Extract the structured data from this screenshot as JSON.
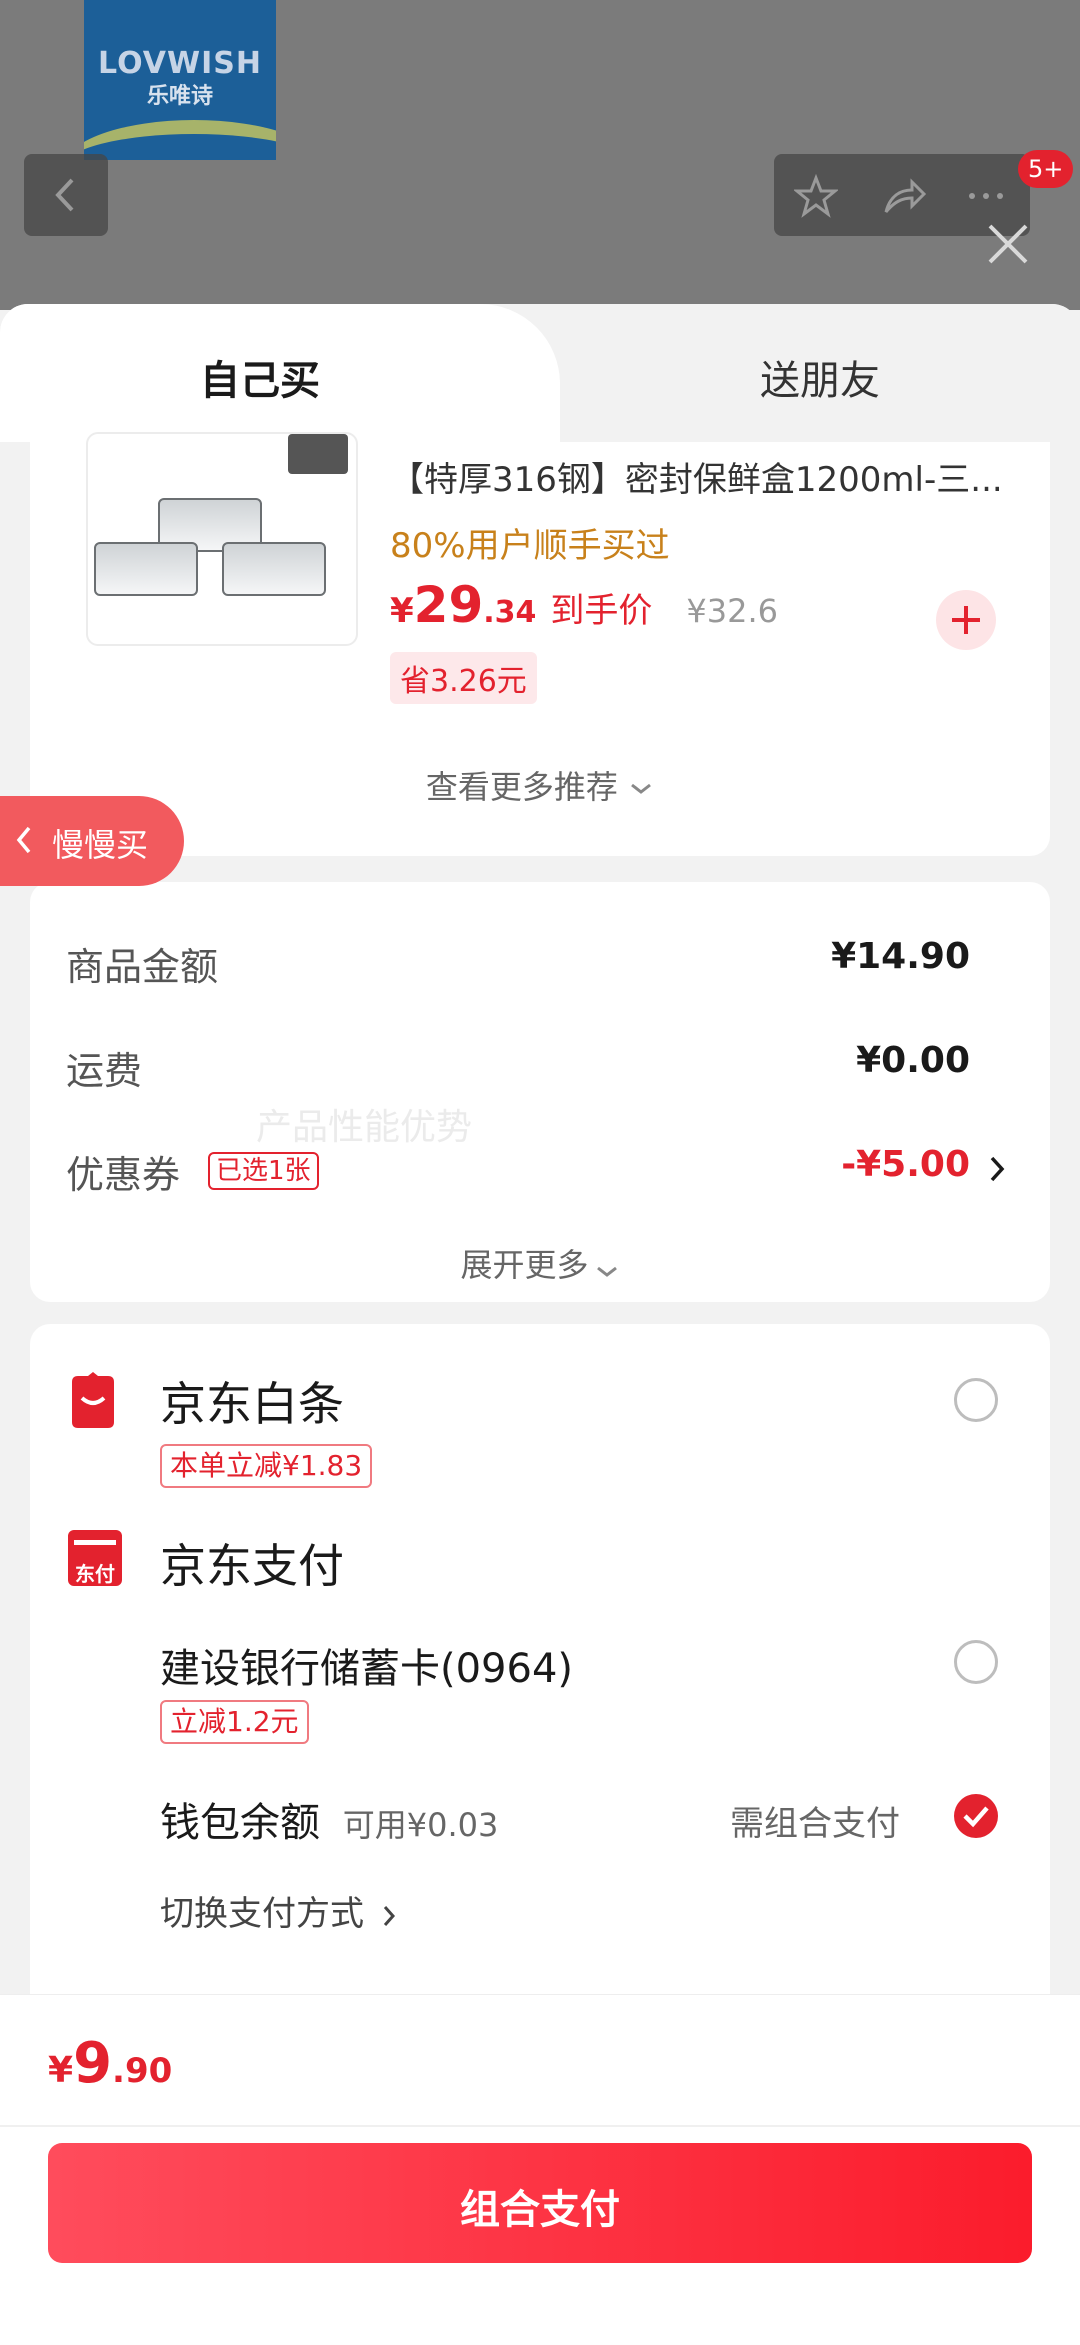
{
  "brand": {
    "logo_text": "LOVWISH",
    "logo_sub": "乐唯诗"
  },
  "header": {
    "cart_badge": "5+"
  },
  "tabs": {
    "self_buy": "自己买",
    "gift_friend": "送朋友"
  },
  "recommend": {
    "title": "【特厚316钢】密封保鲜盒1200ml-三...",
    "bought_text": "80%用户顺手买过",
    "price_symbol": "¥",
    "price_int": "29",
    "price_dec": ".34",
    "price_tag": "到手价",
    "original_price": "¥32.6",
    "save_text": "省3.26元",
    "more_label": "查看更多推荐"
  },
  "slow_buy_label": "慢慢买",
  "summary": {
    "goods_label": "商品金额",
    "goods_value": "¥14.90",
    "shipping_label": "运费",
    "shipping_value": "¥0.00",
    "coupon_label": "优惠券",
    "coupon_tag": "已选1张",
    "coupon_value": "-¥5.00",
    "expand_label": "展开更多",
    "watermark": "产品性能优势"
  },
  "payment": {
    "baitiao_name": "京东白条",
    "baitiao_promo": "本单立减¥1.83",
    "jdpay_name": "京东支付",
    "jdpay_icon_text": "东付",
    "bank_name": "建设银行储蓄卡(0964)",
    "bank_promo": "立减1.2元",
    "wallet_name": "钱包余额",
    "wallet_available": "可用¥0.03",
    "wallet_note": "需组合支付",
    "switch_label": "切换支付方式"
  },
  "footer": {
    "total_symbol": "¥",
    "total_int": "9",
    "total_dec": ".90",
    "pay_button": "组合支付"
  },
  "colors": {
    "accent": "#e3222e",
    "orange": "#c8811b"
  }
}
